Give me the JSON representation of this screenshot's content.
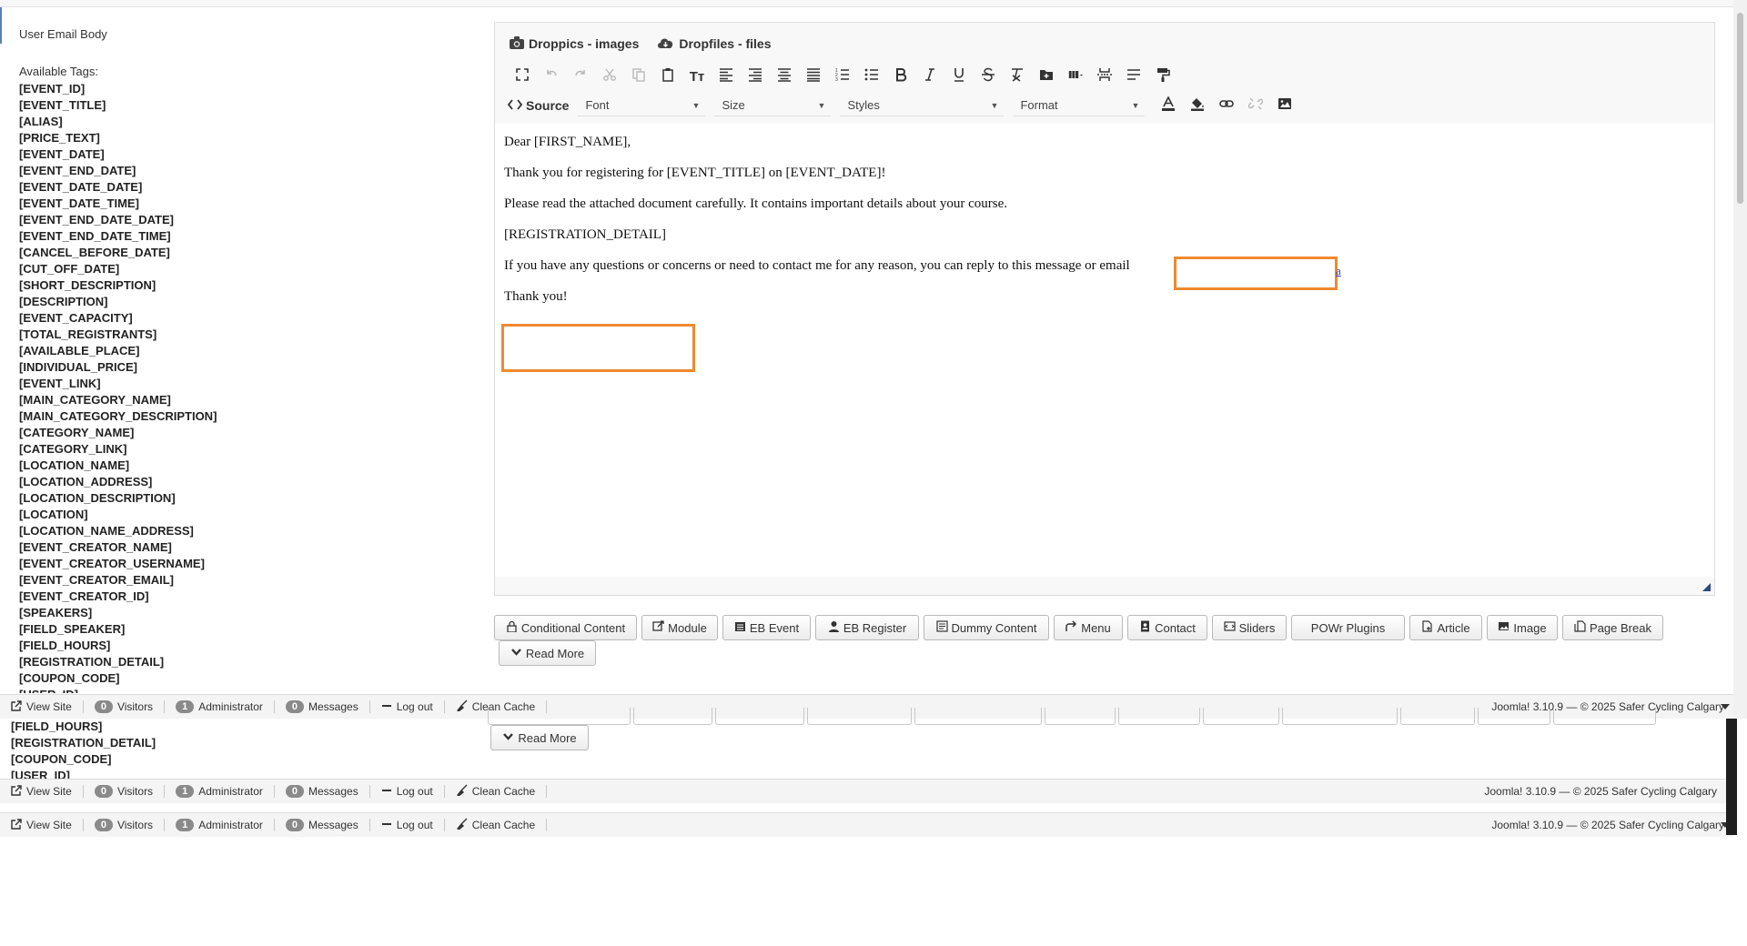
{
  "left": {
    "field_label": "User Email Body",
    "tags_heading": "Available Tags:",
    "tags": [
      "[EVENT_ID]",
      "[EVENT_TITLE]",
      "[ALIAS]",
      "[PRICE_TEXT]",
      "[EVENT_DATE]",
      "[EVENT_END_DATE]",
      "[EVENT_DATE_DATE]",
      "[EVENT_DATE_TIME]",
      "[EVENT_END_DATE_DATE]",
      "[EVENT_END_DATE_TIME]",
      "[CANCEL_BEFORE_DATE]",
      "[CUT_OFF_DATE]",
      "[SHORT_DESCRIPTION]",
      "[DESCRIPTION]",
      "[EVENT_CAPACITY]",
      "[TOTAL_REGISTRANTS]",
      "[AVAILABLE_PLACE]",
      "[INDIVIDUAL_PRICE]",
      "[EVENT_LINK]",
      "[MAIN_CATEGORY_NAME]",
      "[MAIN_CATEGORY_DESCRIPTION]",
      "[CATEGORY_NAME]",
      "[CATEGORY_LINK]",
      "[LOCATION_NAME]",
      "[LOCATION_ADDRESS]",
      "[LOCATION_DESCRIPTION]",
      "[LOCATION]",
      "[LOCATION_NAME_ADDRESS]",
      "[EVENT_CREATOR_NAME]",
      "[EVENT_CREATOR_USERNAME]",
      "[EVENT_CREATOR_EMAIL]",
      "[EVENT_CREATOR_ID]",
      "[SPEAKERS]",
      "[FIELD_SPEAKER]",
      "[FIELD_HOURS]",
      "[REGISTRATION_DETAIL]",
      "[COUPON_CODE]",
      "[USER_ID]"
    ]
  },
  "editor": {
    "plugins": {
      "droppics": "Droppics - images",
      "dropfiles": "Dropfiles - files"
    },
    "toolbar": {
      "source": "Source",
      "font": "Font",
      "size": "Size",
      "styles": "Styles",
      "format": "Format",
      "text_style_glyph": "Tт"
    },
    "content": {
      "line1": "Dear [FIRST_NAME],",
      "line2": "Thank you for registering for [EVENT_TITLE] on [EVENT_DATE]!",
      "line3": "Please read the attached document carefully. It contains important details about your course.",
      "line4": "[REGISTRATION_DETAIL]",
      "line5": "If you have any questions or concerns or need to contact me for any reason, you can reply to this message or email",
      "email_trail": "a",
      "line6": "Thank you!"
    }
  },
  "xtd_buttons": {
    "conditional": "Conditional Content",
    "module": "Module",
    "eb_event": "EB Event",
    "eb_register": "EB Register",
    "dummy": "Dummy Content",
    "menu": "Menu",
    "contact": "Contact",
    "sliders": "Sliders",
    "powr": "POWr Plugins",
    "article": "Article",
    "image": "Image",
    "pagebreak": "Page Break",
    "readmore": "Read More"
  },
  "status": {
    "view_site": "View Site",
    "visitors_count": "0",
    "visitors": "Visitors",
    "admin_count": "1",
    "admin": "Administrator",
    "messages_count": "0",
    "messages": "Messages",
    "logout": "Log out",
    "clean_cache": "Clean Cache",
    "version": "Joomla! 3.10.9",
    "sep": "—",
    "copyright": "© 2025 Safer Cycling Calgary"
  },
  "ghost": {
    "tags": [
      "[FIELD_HOURS]",
      "[REGISTRATION_DETAIL]",
      "[COUPON_CODE]",
      "[USER_ID]"
    ],
    "readmore": "Read More"
  },
  "colors": {
    "highlight": "#f0892f",
    "link": "#1a3fc4",
    "badge": "#8a8a8a"
  }
}
